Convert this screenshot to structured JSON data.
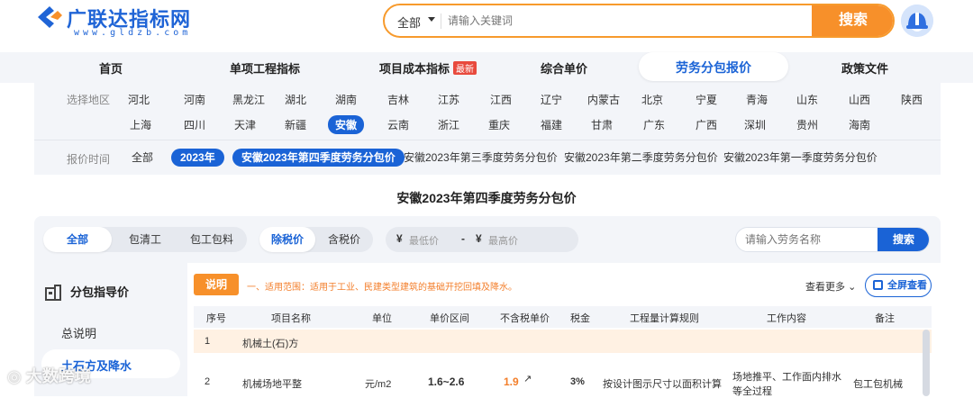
{
  "header": {
    "logo_text": "广联达指标网",
    "logo_url": "www.gldzb.com",
    "search_category": "全部",
    "search_placeholder": "请输入关键词",
    "search_button": "搜索"
  },
  "nav": {
    "items": [
      "首页",
      "单项工程指标",
      "项目成本指标",
      "综合单价",
      "劳务分包报价",
      "政策文件"
    ],
    "new_badge": "最新",
    "active": "劳务分包报价"
  },
  "filters": {
    "region_label": "选择地区",
    "regions_row1": [
      "河北",
      "河南",
      "黑龙江",
      "湖北",
      "湖南",
      "吉林",
      "江苏",
      "江西",
      "辽宁",
      "内蒙古",
      "北京",
      "宁夏",
      "青海",
      "山东",
      "山西",
      "陕西"
    ],
    "regions_row2": [
      "上海",
      "四川",
      "天津",
      "新疆",
      "安徽",
      "云南",
      "浙江",
      "重庆",
      "福建",
      "甘肃",
      "广东",
      "广西",
      "深圳",
      "贵州",
      "海南"
    ],
    "selected_region": "安徽",
    "time_label": "报价时间",
    "time_all": "全部",
    "time_year": "2023年",
    "periods": [
      "安徽2023年第四季度劳务分包价",
      "安徽2023年第三季度劳务分包价",
      "安徽2023年第二季度劳务分包价",
      "安徽2023年第一季度劳务分包价"
    ]
  },
  "page_title": "安徽2023年第四季度劳务分包价",
  "toolbar": {
    "scope_options": [
      "全部",
      "包清工",
      "包工包料"
    ],
    "tax_options": [
      "除税价",
      "含税价"
    ],
    "min_price": "最低价",
    "max_price": "最高价",
    "currency": "¥",
    "dash": "-",
    "labor_search_placeholder": "请输入劳务名称",
    "labor_search_button": "搜索"
  },
  "sidebar": {
    "heading": "分包指导价",
    "items": [
      "总说明",
      "土石方及降水"
    ],
    "selected": "土石方及降水"
  },
  "content": {
    "note_tag": "说明",
    "note_text": "一、适用范围：适用于工业、民建类型建筑的基础开挖回填及降水。",
    "more": "查看更多",
    "fullscreen": "全屏查看",
    "columns": [
      "序号",
      "项目名称",
      "单位",
      "单价区间",
      "不含税单价",
      "税金",
      "工程量计算规则",
      "工作内容",
      "备注"
    ],
    "rows": [
      {
        "no": "1",
        "name": "机械土(石)方"
      },
      {
        "no": "2",
        "name": "机械场地平整",
        "unit": "元/m2",
        "range": "1.6~2.6",
        "price": "1.9",
        "tax": "3%",
        "rule": "按设计图示尺寸以面积计算",
        "work1": "场地推平、工作面内排水",
        "work2": "等全过程",
        "remark": "包工包机械"
      }
    ]
  },
  "watermark": "大数跨境"
}
